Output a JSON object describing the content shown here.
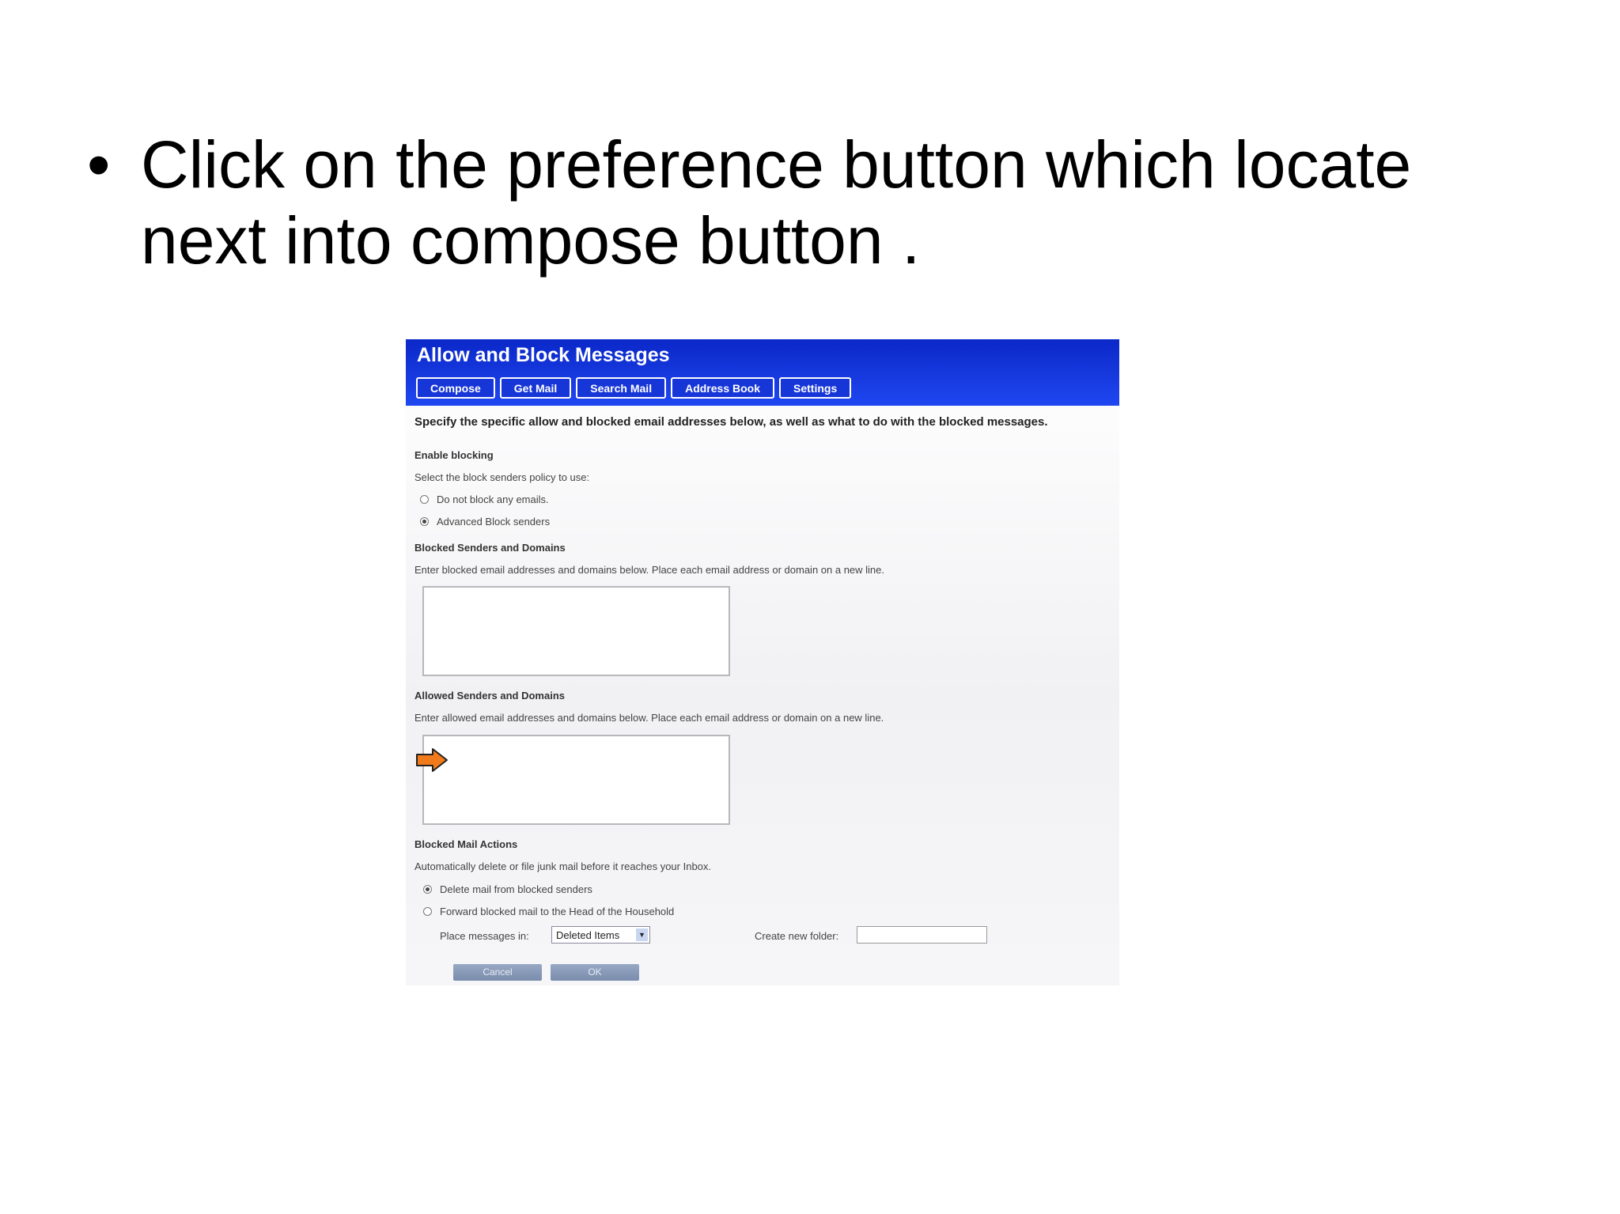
{
  "slide": {
    "bullet": "•",
    "line1": "Click on the preference button which locate",
    "line2": "next into compose button ."
  },
  "window": {
    "title": "Allow and Block Messages",
    "toolbar": [
      "Compose",
      "Get Mail",
      "Search Mail",
      "Address Book",
      "Settings"
    ],
    "intro": "Specify the specific allow and blocked email addresses below, as well as what to do with the blocked messages."
  },
  "blocking": {
    "heading": "Enable blocking",
    "prompt": "Select the block senders policy to use:",
    "options": [
      {
        "label": "Do not block any emails.",
        "selected": false
      },
      {
        "label": "Advanced Block senders",
        "selected": true
      }
    ]
  },
  "blocked": {
    "heading": "Blocked Senders and Domains",
    "help": "Enter blocked email addresses and domains below. Place each email address or domain on a new line.",
    "value": ""
  },
  "allowed": {
    "heading": "Allowed Senders and Domains",
    "help": "Enter allowed email addresses and domains below. Place each email address or domain on a new line.",
    "value": ""
  },
  "actions": {
    "heading": "Blocked Mail Actions",
    "help": "Automatically delete or file junk mail before it reaches your Inbox.",
    "options": [
      {
        "label": "Delete mail from blocked senders",
        "selected": true
      },
      {
        "label": "Forward blocked mail to the Head of the Household",
        "selected": false
      }
    ],
    "place_label": "Place messages in:",
    "place_value": "Deleted Items",
    "folder_label": "Create new folder:",
    "folder_value": "",
    "cancel": "Cancel",
    "ok": "OK"
  },
  "colors": {
    "header": "#1736d8",
    "pointer": "#f07a1c"
  },
  "icons": {
    "pointer": "arrow-right-icon",
    "select": "chevron-down-icon"
  }
}
